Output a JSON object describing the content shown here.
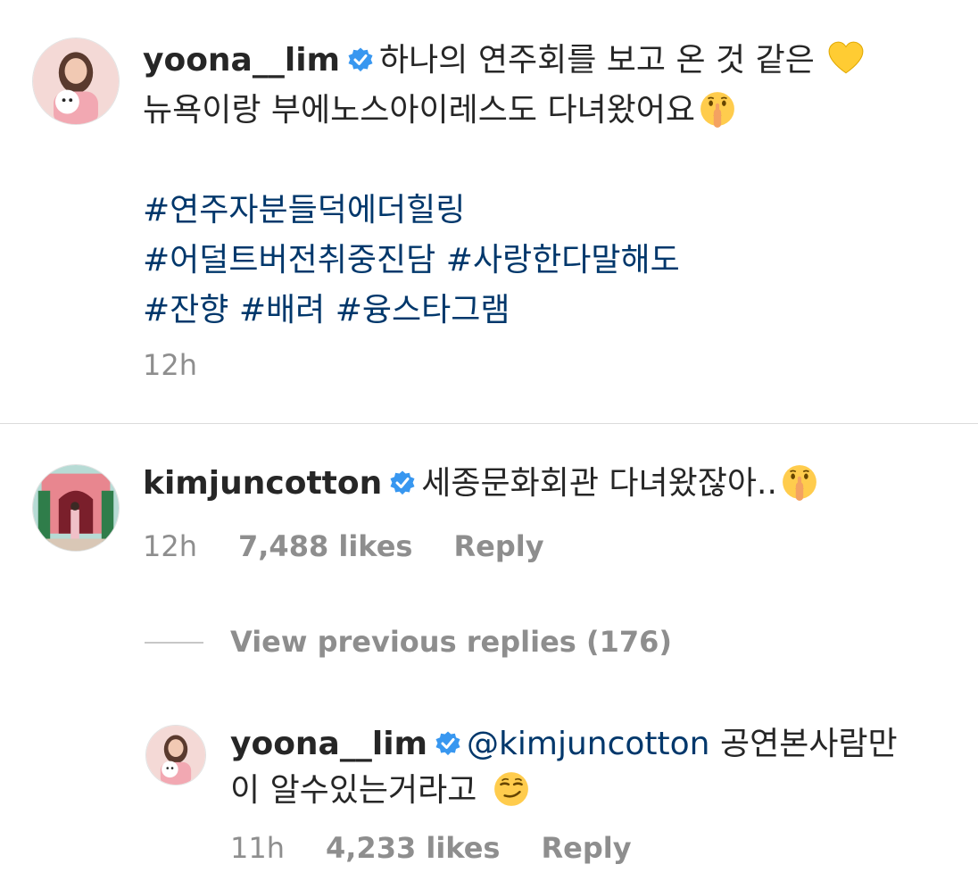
{
  "post": {
    "username": "yoona__lim",
    "caption_line1": "하나의 연주회를 보고 온 것 같은",
    "caption_line2": "뉴욕이랑 부에노스아이레스도 다녀왔어요",
    "hashtags": [
      "#연주자분들덕에더힐링",
      "#어덜트버전취중진담",
      "#사랑한다말해도",
      "#잔향",
      "#배려",
      "#융스타그램"
    ],
    "time": "12h",
    "emoji_heart": "yellow-heart-icon",
    "emoji_shush": "shushing-face-icon"
  },
  "comment": {
    "username": "kimjuncotton",
    "text": "세종문화회관 다녀왔잖아..",
    "time": "12h",
    "likes": "7,488 likes",
    "reply_label": "Reply"
  },
  "view_replies": "View previous replies (176)",
  "reply": {
    "username": "yoona__lim",
    "mention": "@kimjuncotton",
    "text_line1": "공연본사람만",
    "text_line2": "이 알수있는거라고",
    "time": "11h",
    "likes": "4,233 likes",
    "reply_label": "Reply"
  },
  "colors": {
    "hashtag": "#00376b",
    "verified": "#3897f0",
    "meta": "#8e8e8e"
  }
}
